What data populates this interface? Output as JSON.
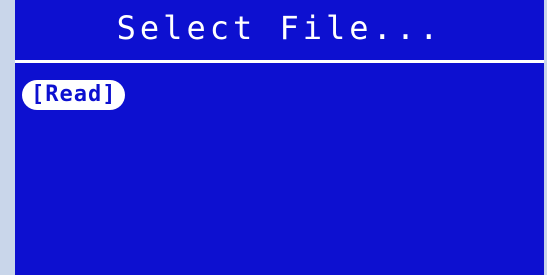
{
  "header": {
    "title": "Select File..."
  },
  "file_list": {
    "items": [
      {
        "label": "[Read]"
      }
    ]
  },
  "colors": {
    "screen_background": "#0d10d0",
    "text": "#ffffff",
    "frame": "#c9d6ea"
  }
}
